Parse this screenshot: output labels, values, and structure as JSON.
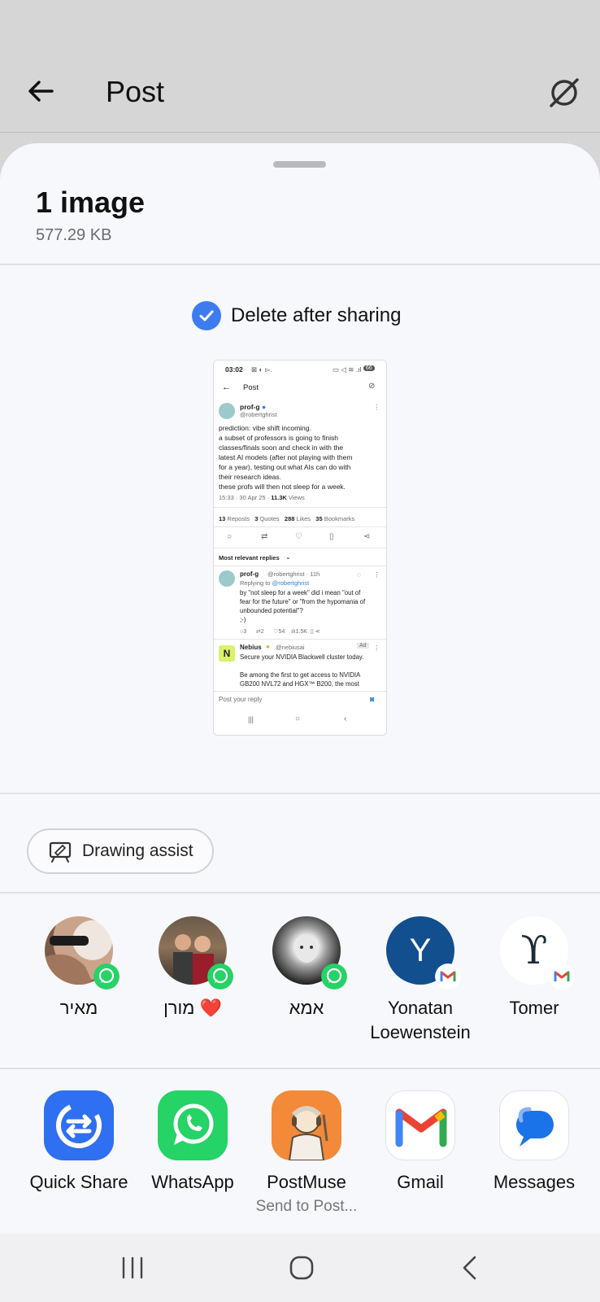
{
  "topbar": {
    "title": "Post"
  },
  "sheet": {
    "count_label": "1 image",
    "size_label": "577.29 KB",
    "delete_after_sharing": {
      "label": "Delete after sharing",
      "checked": true
    }
  },
  "thumbnail": {
    "status_time": "03:02",
    "status_battery": "66",
    "header_title": "Post",
    "author_name": "prof-g",
    "author_handle": "@robertghrist",
    "tweet_lines": [
      "prediction: vibe shift incoming.",
      "a subset of professors is going to finish",
      "classes/finals soon and check in with the",
      "latest AI models (after not playing with them",
      "for a year), testing out what AIs can do with",
      "their research ideas.",
      "these profs will then not sleep for a week."
    ],
    "meta_time": "15:33 · 30 Apr 25 · ",
    "meta_views_count": "11.3K",
    "meta_views_label": " Views",
    "stats": [
      {
        "count": "13",
        "label": " Reposts"
      },
      {
        "count": "3",
        "label": " Quotes"
      },
      {
        "count": "288",
        "label": " Likes"
      },
      {
        "count": "35",
        "label": " Bookmarks"
      }
    ],
    "replies_header": "Most relevant replies",
    "reply_author": "prof-g",
    "reply_handle": "@robertghrist · 11h",
    "reply_to_prefix": "Replying to ",
    "reply_to_handle": "@robertghrist",
    "reply_lines": [
      "by \"not sleep for a week\" did i mean \"out of",
      "fear for the future\" or \"from the hypomania of",
      "unbounded potential\"?",
      ";-)"
    ],
    "reply_stats": {
      "replies": "3",
      "reposts": "2",
      "likes": "54",
      "views": "1.5K"
    },
    "ad_name": "Nebius",
    "ad_handle": "@nebiusai",
    "ad_tag": "Ad",
    "ad_logo": "N",
    "ad_lines": [
      "Secure your NVIDIA Blackwell cluster today.",
      "",
      "Be among the first to get access to NVIDIA",
      "GB200 NVL72 and HGX™ B200, the most"
    ],
    "reply_placeholder": "Post your reply"
  },
  "drawing_assist": {
    "label": "Drawing assist"
  },
  "contacts": [
    {
      "name": "מאיר",
      "badge": "whatsapp"
    },
    {
      "name": "מורן ❤️",
      "badge": "whatsapp"
    },
    {
      "name": "אמא",
      "badge": "whatsapp"
    },
    {
      "name": "Yonatan Loewenstein",
      "initial": "Y",
      "badge": "gmail"
    },
    {
      "name": "Tomer",
      "initial": "ϒ",
      "badge": "gmail"
    }
  ],
  "apps": [
    {
      "name": "Quick Share",
      "sub": ""
    },
    {
      "name": "WhatsApp",
      "sub": ""
    },
    {
      "name": "PostMuse",
      "sub": "Send to Post..."
    },
    {
      "name": "Gmail",
      "sub": ""
    },
    {
      "name": "Messages",
      "sub": ""
    }
  ],
  "colors": {
    "accent_blue": "#3d7bf0",
    "whatsapp_green": "#25d366",
    "quickshare_blue": "#2f6ff1",
    "sheet_bg": "#f7f8fc",
    "topbar_bg": "#d6d6d6"
  }
}
